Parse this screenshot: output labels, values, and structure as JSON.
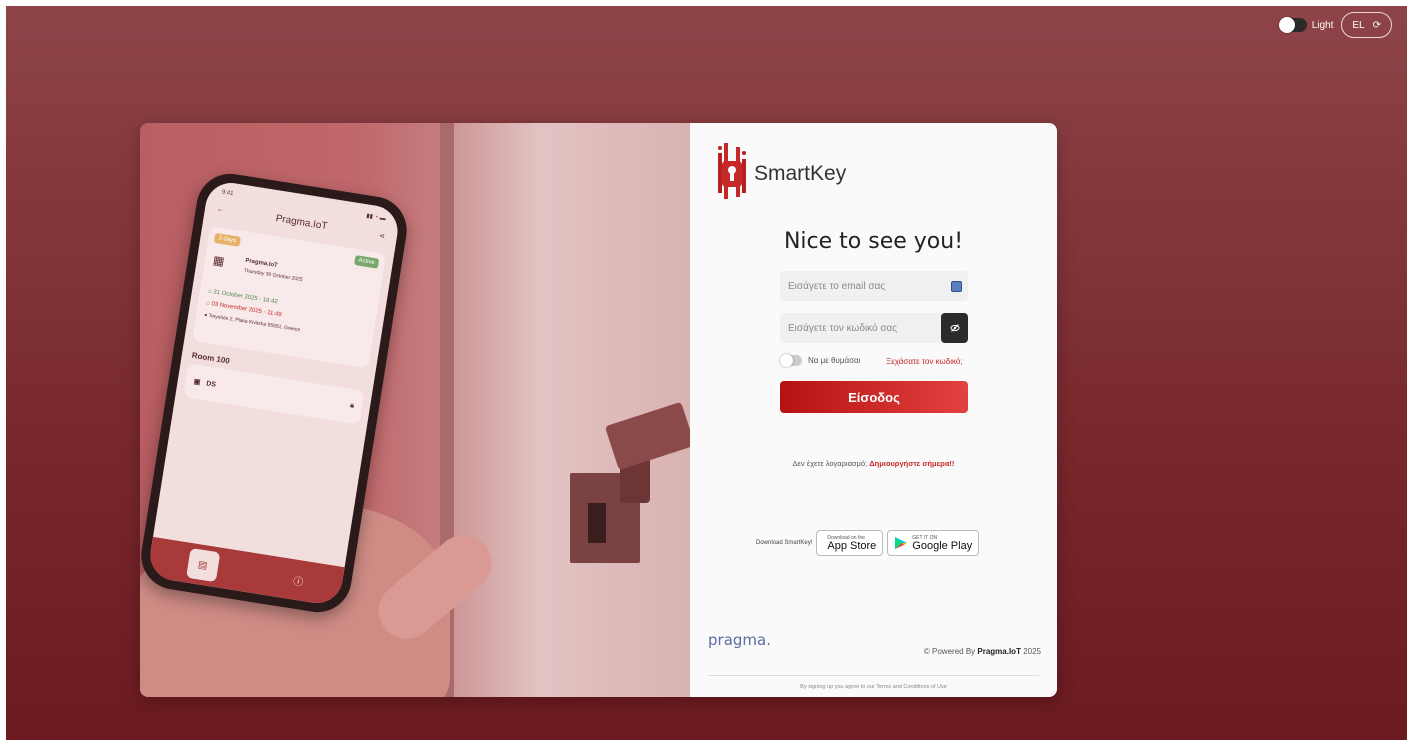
{
  "controls": {
    "theme_label": "Light",
    "language": "EL"
  },
  "phone_app": {
    "time": "9:41",
    "title": "Pragma.IoT",
    "duration_badge": "3 days",
    "status_badge": "Active",
    "company": "Pragma.IoT",
    "date": "Thursday 30 October 2025",
    "checkin": "31 October 2025 - 16:42",
    "checkout": "03 November 2025 - 11:49",
    "address": "Τσιγαλάκ 2, Plaka Kivitsha 55551, Greece",
    "room": "Room 100",
    "device": "DS"
  },
  "brand": {
    "name": "SmartKey"
  },
  "login": {
    "greeting": "Nice to see you!",
    "email_placeholder": "Εισάγετε το email σας",
    "password_placeholder": "Εισάγετε τον κωδικό σας",
    "remember_label": "Να με θυμάσαι",
    "forgot_label": "Ξεχάσατε τον κωδικό;",
    "submit_label": "Είσοδος",
    "no_account_text": "Δεν έχετε λογαριασμό;",
    "signup_link": "Δημιουργήστε σήμερα!!"
  },
  "downloads": {
    "label": "Download SmartKey!",
    "appstore_small": "Download on the",
    "appstore_big": "App Store",
    "googleplay_small": "GET IT ON",
    "googleplay_big": "Google Play"
  },
  "footer": {
    "pragma_logo": "pragma.",
    "powered_prefix": "© Powered By ",
    "powered_brand": "Pragma.IoT",
    "powered_year": " 2025",
    "terms": "By signing up you agree to our Terms and Conditions of Use"
  },
  "colors": {
    "accent": "#c62828",
    "background": "#7a2a2e"
  }
}
